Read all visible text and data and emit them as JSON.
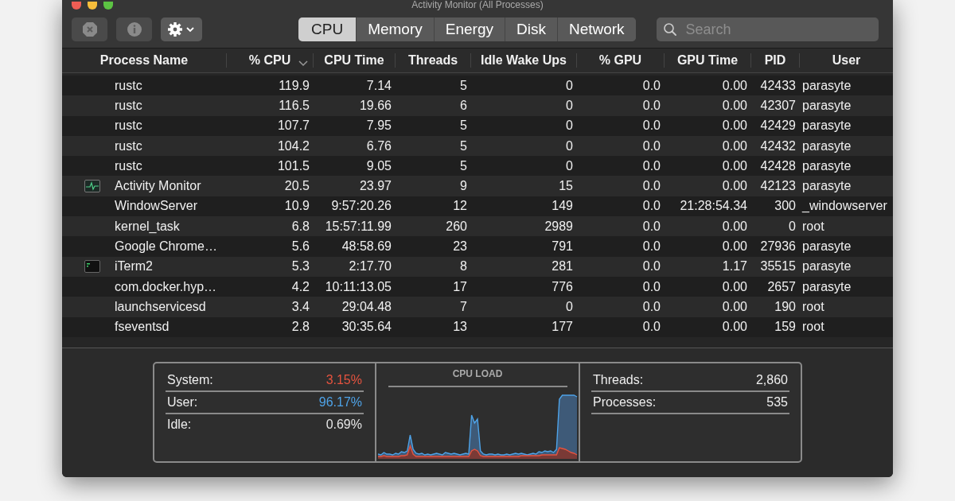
{
  "window": {
    "title": "Activity Monitor (All Processes)"
  },
  "toolbar": {
    "buttons": [
      {
        "kind": "stop",
        "disabled": true
      },
      {
        "kind": "info",
        "disabled": true
      },
      {
        "kind": "gear",
        "disabled": false
      }
    ]
  },
  "tabs": [
    {
      "label": "CPU",
      "selected": true
    },
    {
      "label": "Memory",
      "selected": false
    },
    {
      "label": "Energy",
      "selected": false
    },
    {
      "label": "Disk",
      "selected": false
    },
    {
      "label": "Network",
      "selected": false
    }
  ],
  "search": {
    "placeholder": "Search"
  },
  "table": {
    "columns": [
      {
        "label": "Process Name",
        "sorted": false
      },
      {
        "label": "% CPU",
        "sorted": true
      },
      {
        "label": "CPU Time",
        "sorted": false
      },
      {
        "label": "Threads",
        "sorted": false
      },
      {
        "label": "Idle Wake Ups",
        "sorted": false
      },
      {
        "label": "% GPU",
        "sorted": false
      },
      {
        "label": "GPU Time",
        "sorted": false
      },
      {
        "label": "PID",
        "sorted": false
      },
      {
        "label": "User",
        "sorted": false
      }
    ],
    "rows": [
      {
        "kind": "plain",
        "cells": [
          "rustc",
          "119.9",
          "7.14",
          "5",
          "0",
          "0.0",
          "0.00",
          "42433",
          "parasyte"
        ]
      },
      {
        "kind": "plain",
        "cells": [
          "rustc",
          "116.5",
          "19.66",
          "6",
          "0",
          "0.0",
          "0.00",
          "42307",
          "parasyte"
        ]
      },
      {
        "kind": "plain",
        "cells": [
          "rustc",
          "107.7",
          "7.95",
          "5",
          "0",
          "0.0",
          "0.00",
          "42429",
          "parasyte"
        ]
      },
      {
        "kind": "plain",
        "cells": [
          "rustc",
          "104.2",
          "6.76",
          "5",
          "0",
          "0.0",
          "0.00",
          "42432",
          "parasyte"
        ]
      },
      {
        "kind": "plain",
        "cells": [
          "rustc",
          "101.5",
          "9.05",
          "5",
          "0",
          "0.0",
          "0.00",
          "42428",
          "parasyte"
        ]
      },
      {
        "kind": "activity",
        "cells": [
          "Activity Monitor",
          "20.5",
          "23.97",
          "9",
          "15",
          "0.0",
          "0.00",
          "42123",
          "parasyte"
        ]
      },
      {
        "kind": "plain",
        "cells": [
          "WindowServer",
          "10.9",
          "9:57:20.26",
          "12",
          "149",
          "0.0",
          "21:28:54.34",
          "300",
          "_windowserver"
        ]
      },
      {
        "kind": "plain",
        "cells": [
          "kernel_task",
          "6.8",
          "15:57:11.99",
          "260",
          "2989",
          "0.0",
          "0.00",
          "0",
          "root"
        ]
      },
      {
        "kind": "plain",
        "cells": [
          "Google Chrome…",
          "5.6",
          "48:58.69",
          "23",
          "791",
          "0.0",
          "0.00",
          "27936",
          "parasyte"
        ]
      },
      {
        "kind": "terminal",
        "cells": [
          "iTerm2",
          "5.3",
          "2:17.70",
          "8",
          "281",
          "0.0",
          "1.17",
          "35515",
          "parasyte"
        ]
      },
      {
        "kind": "plain",
        "cells": [
          "com.docker.hyp…",
          "4.2",
          "10:11:13.05",
          "17",
          "776",
          "0.0",
          "0.00",
          "2657",
          "parasyte"
        ]
      },
      {
        "kind": "plain",
        "cells": [
          "launchservicesd",
          "3.4",
          "29:04.48",
          "7",
          "0",
          "0.0",
          "0.00",
          "190",
          "root"
        ]
      },
      {
        "kind": "plain",
        "cells": [
          "fseventsd",
          "2.8",
          "30:35.64",
          "13",
          "177",
          "0.0",
          "0.00",
          "159",
          "root"
        ]
      }
    ]
  },
  "summary": {
    "stats": [
      {
        "label": "System:",
        "value": "3.15%",
        "color": "#e5533f"
      },
      {
        "label": "User:",
        "value": "96.17%",
        "color": "#4ea3e8"
      },
      {
        "label": "Idle:",
        "value": "0.69%",
        "color": "#e6e6e6"
      }
    ],
    "chart_title": "CPU LOAD",
    "counts": [
      {
        "label": "Threads:",
        "value": "2,860"
      },
      {
        "label": "Processes:",
        "value": "535"
      }
    ]
  }
}
